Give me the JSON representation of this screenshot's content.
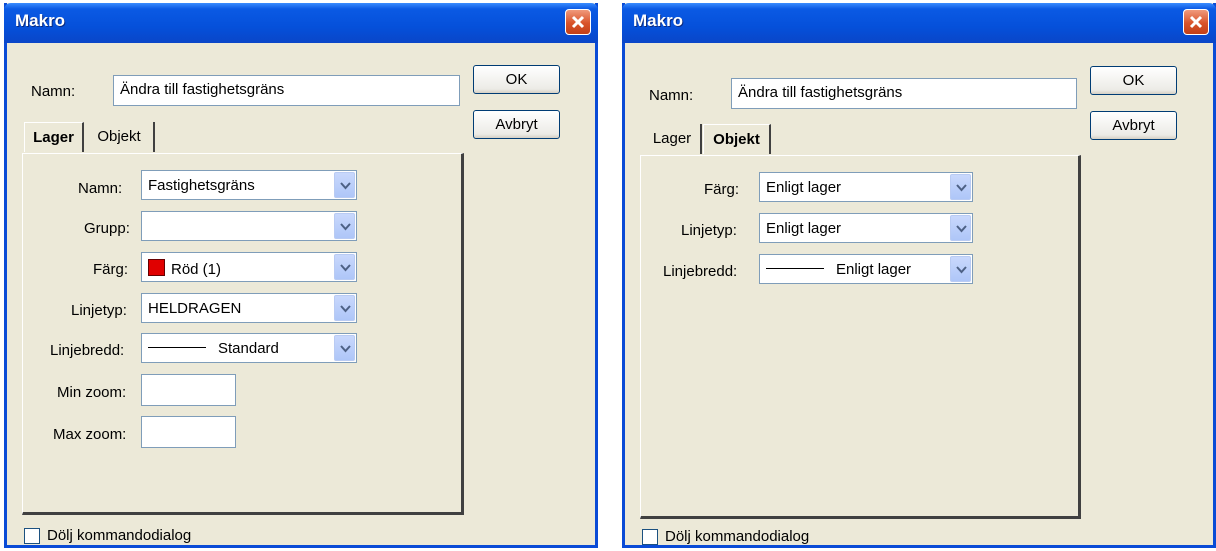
{
  "dialogs": [
    {
      "title": "Makro",
      "name_label": "Namn:",
      "name_value": "Ändra till fastighetsgräns",
      "ok_label": "OK",
      "cancel_label": "Avbryt",
      "tabs": [
        "Lager",
        "Objekt"
      ],
      "active_tab": "Lager",
      "lager_fields": {
        "namn_label": "Namn:",
        "namn_value": "Fastighetsgräns",
        "grupp_label": "Grupp:",
        "grupp_value": "",
        "farg_label": "Färg:",
        "farg_value": "Röd (1)",
        "farg_color": "#e00000",
        "linjetyp_label": "Linjetyp:",
        "linjetyp_value": "HELDRAGEN",
        "linjebredd_label": "Linjebredd:",
        "linjebredd_value": "Standard",
        "minzoom_label": "Min zoom:",
        "minzoom_value": "",
        "maxzoom_label": "Max zoom:",
        "maxzoom_value": ""
      },
      "hide_dialog_label": "Dölj kommandodialog",
      "hide_dialog_checked": false
    },
    {
      "title": "Makro",
      "name_label": "Namn:",
      "name_value": "Ändra till fastighetsgräns",
      "ok_label": "OK",
      "cancel_label": "Avbryt",
      "tabs": [
        "Lager",
        "Objekt"
      ],
      "active_tab": "Objekt",
      "objekt_fields": {
        "farg_label": "Färg:",
        "farg_value": "Enligt lager",
        "linjetyp_label": "Linjetyp:",
        "linjetyp_value": "Enligt lager",
        "linjebredd_label": "Linjebredd:",
        "linjebredd_value": "Enligt lager"
      },
      "hide_dialog_label": "Dölj kommandodialog",
      "hide_dialog_checked": false
    }
  ]
}
